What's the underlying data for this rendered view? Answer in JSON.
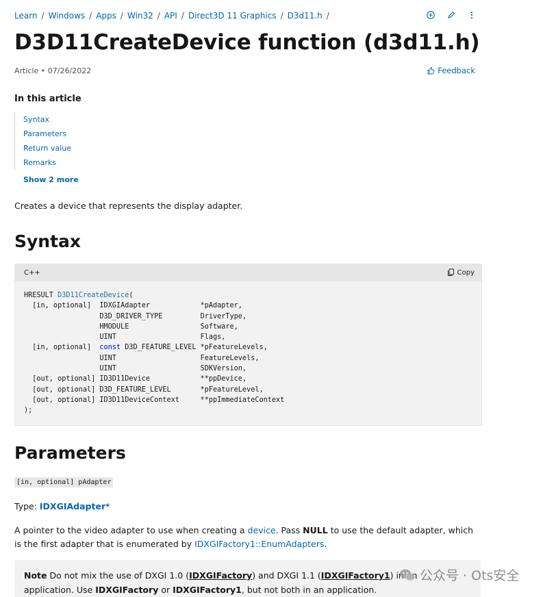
{
  "breadcrumb": [
    "Learn",
    "Windows",
    "Apps",
    "Win32",
    "API",
    "Direct3D 11 Graphics",
    "D3d11.h"
  ],
  "breadcrumb_separator": "/",
  "breadcrumb_trailing": "/",
  "header_icons": [
    "add-circle-icon",
    "pencil-icon",
    "more-vertical-icon"
  ],
  "title": "D3D11CreateDevice function (d3d11.h)",
  "meta": {
    "type": "Article",
    "bullet": "•",
    "date": "07/26/2022"
  },
  "feedback_label": "Feedback",
  "toc": {
    "title": "In this article",
    "items": [
      "Syntax",
      "Parameters",
      "Return value",
      "Remarks"
    ],
    "show_more": "Show 2 more"
  },
  "description": "Creates a device that represents the display adapter.",
  "syntax": {
    "heading": "Syntax",
    "language": "C++",
    "copy_label": "Copy"
  },
  "parameters": {
    "heading": "Parameters",
    "param_tag": "[in, optional] pAdapter",
    "type_prefix": "Type: ",
    "type_value": "IDXGIAdapter",
    "type_suffix": "*",
    "desc_1": "A pointer to the video adapter to use when creating a ",
    "desc_link_device": "device",
    "desc_2": ". Pass ",
    "desc_null": "NULL",
    "desc_3": " to use the default adapter, which is the first adapter that is enumerated by ",
    "desc_link_enum": "IDXGIFactory1::EnumAdapters",
    "desc_4": "."
  },
  "note": {
    "label": "Note",
    "t1": "  Do not mix the use of DXGI 1.0 (",
    "link1": "IDXGIFactory",
    "t2": ") and DXGI 1.1 (",
    "link2": "IDXGIFactory1",
    "t3": ") in an application. Use ",
    "b1": "IDXGIFactory",
    "t4": " or ",
    "b2": "IDXGIFactory1",
    "t5": ", but not both in an application."
  },
  "watermark": "公众号 · Ots安全",
  "colors": {
    "link": "#0065b3",
    "code_bg": "#f2f2f2",
    "keyword": "#0101fd"
  }
}
